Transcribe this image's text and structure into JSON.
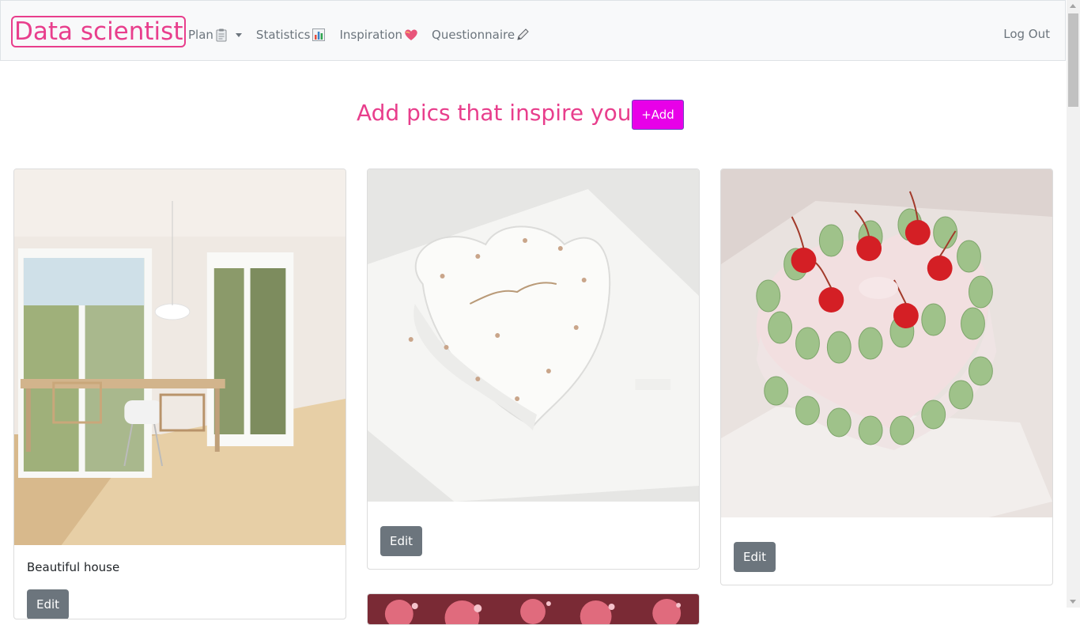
{
  "navbar": {
    "brand": "Data scientist",
    "links": [
      {
        "label": "Plan",
        "icon": "clipboard-icon",
        "dropdown": true
      },
      {
        "label": "Statistics",
        "icon": "bar-chart-icon"
      },
      {
        "label": "Inspiration",
        "icon": "heart-icon"
      },
      {
        "label": "Questionnaire",
        "icon": "pencil-icon"
      }
    ],
    "logout": "Log Out"
  },
  "header": {
    "title": "Add pics that inspire you!",
    "add_button": "+Add"
  },
  "cards": [
    {
      "caption": "Beautiful house",
      "edit_label": "Edit",
      "image": "house-photo"
    },
    {
      "caption": "",
      "edit_label": "Edit",
      "image": "heart-cake-white-photo"
    },
    {
      "caption": "",
      "edit_label": "Edit",
      "image": "heart-cake-cherries-photo"
    },
    {
      "caption": "",
      "edit_label": "",
      "image": "disco-ball-photo"
    }
  ],
  "colors": {
    "brand": "#e83e8c",
    "add_button_bg": "#e800e8",
    "edit_button_bg": "#6c757d",
    "navbar_bg": "#f8f9fa"
  }
}
